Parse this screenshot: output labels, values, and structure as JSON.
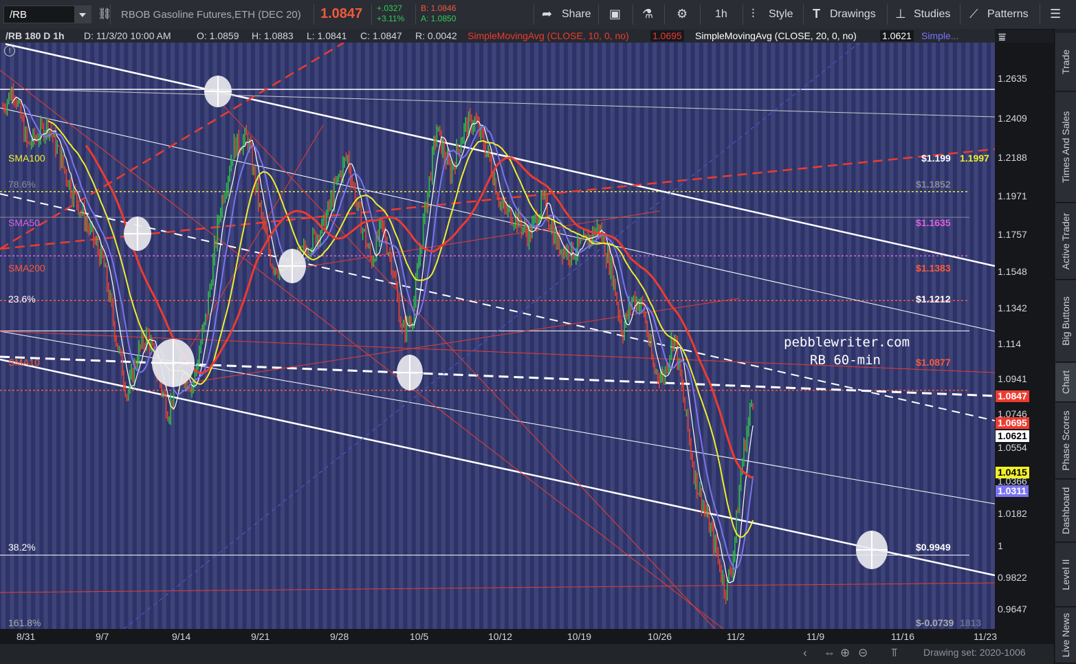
{
  "toolbar": {
    "symbol": "/RB",
    "description": "RBOB Gasoline Futures,ETH (DEC 20)",
    "last": "1.0847",
    "change": "+.0327",
    "change_pct": "+3.11%",
    "bid": "B: 1.0846",
    "ask": "A: 1.0850",
    "share_label": "Share",
    "timeframe_label": "1h",
    "style_label": "Style",
    "drawings_label": "Drawings",
    "studies_label": "Studies",
    "patterns_label": "Patterns"
  },
  "info": {
    "period": "/RB 180 D 1h",
    "date": "D: 11/3/20 10:00 AM",
    "open": "O: 1.0859",
    "high": "H: 1.0883",
    "low": "L: 1.0841",
    "close": "C: 1.0847",
    "range": "R: 0.0042",
    "sma10_label": "SimpleMovingAvg (CLOSE, 10, 0, no)",
    "sma10_value": "1.0695",
    "sma20_label": "SimpleMovingAvg (CLOSE, 20, 0, no)",
    "sma20_value": "1.0621",
    "more": "Simple..."
  },
  "chart_data": {
    "type": "candlestick",
    "symbol": "/RB",
    "interval": "1h",
    "y_ticks": [
      "1.2635",
      "1.2409",
      "1.2188",
      "1.1971",
      "1.1757",
      "1.1548",
      "1.1342",
      "1.114",
      "1.0941",
      "1.0746",
      "1.0554",
      "1.0366",
      "1.0182",
      "1",
      "0.9822",
      "0.9647"
    ],
    "x_ticks": [
      "8/31",
      "9/7",
      "9/14",
      "9/21",
      "9/28",
      "10/5",
      "10/12",
      "10/19",
      "10/26",
      "11/2",
      "11/9",
      "11/16",
      "11/23"
    ],
    "ylim": [
      0.9533,
      1.2836
    ],
    "price_badges": [
      {
        "value": "1.0847",
        "bg": "#ee3b2f",
        "fg": "#ffffff"
      },
      {
        "value": "1.0695",
        "bg": "#ee3b2f",
        "fg": "#ffffff"
      },
      {
        "value": "1.0621",
        "bg": "#ffffff",
        "fg": "#000000"
      },
      {
        "value": "1.0415",
        "bg": "#f2ef2a",
        "fg": "#000000"
      },
      {
        "value": "1.0311",
        "bg": "#7b74f0",
        "fg": "#ffffff"
      }
    ],
    "levels": [
      {
        "left": " ",
        "right": "1.1997",
        "value": 1.1997,
        "color": "#f2ef2a"
      },
      {
        "left": "78.6%",
        "right": "$1.1852",
        "value": 1.1852,
        "color": "#8a8a9a"
      },
      {
        "left": "SMA50",
        "right": "$1.1635",
        "value": 1.1635,
        "color": "#e060e0"
      },
      {
        "left": "SMA200",
        "right": "$1.1383",
        "value": 1.1383,
        "color": "#ff5a3a"
      },
      {
        "left": "23.6%",
        "right": "$1.1212",
        "value": 1.1212,
        "color": "#ffffff"
      },
      {
        "left": "SMA10",
        "right": "$1.0877",
        "value": 1.0877,
        "color": "#ff5a3a"
      },
      {
        "left": "38.2%",
        "right": "$0.9949",
        "value": 0.9949,
        "color": "#ffffff"
      },
      {
        "left": "161.8%",
        "right": "$-0.0739",
        "value": null,
        "color": "#aaaaaa"
      }
    ],
    "overlay_labels": {
      "sma100_left": "SMA100",
      "sma100_right": "$1.199",
      "bottom_right_ghost": "1813"
    },
    "watermark": [
      "pebblewriter.com",
      "RB 60-min"
    ]
  },
  "status": {
    "drawing_set": "Drawing set: 2020-1006"
  },
  "sidebar": {
    "tabs": [
      "Trade",
      "Times And Sales",
      "Active Trader",
      "Big Buttons",
      "Chart",
      "Phase Scores",
      "Dashboard",
      "Level II",
      "Live News"
    ]
  }
}
